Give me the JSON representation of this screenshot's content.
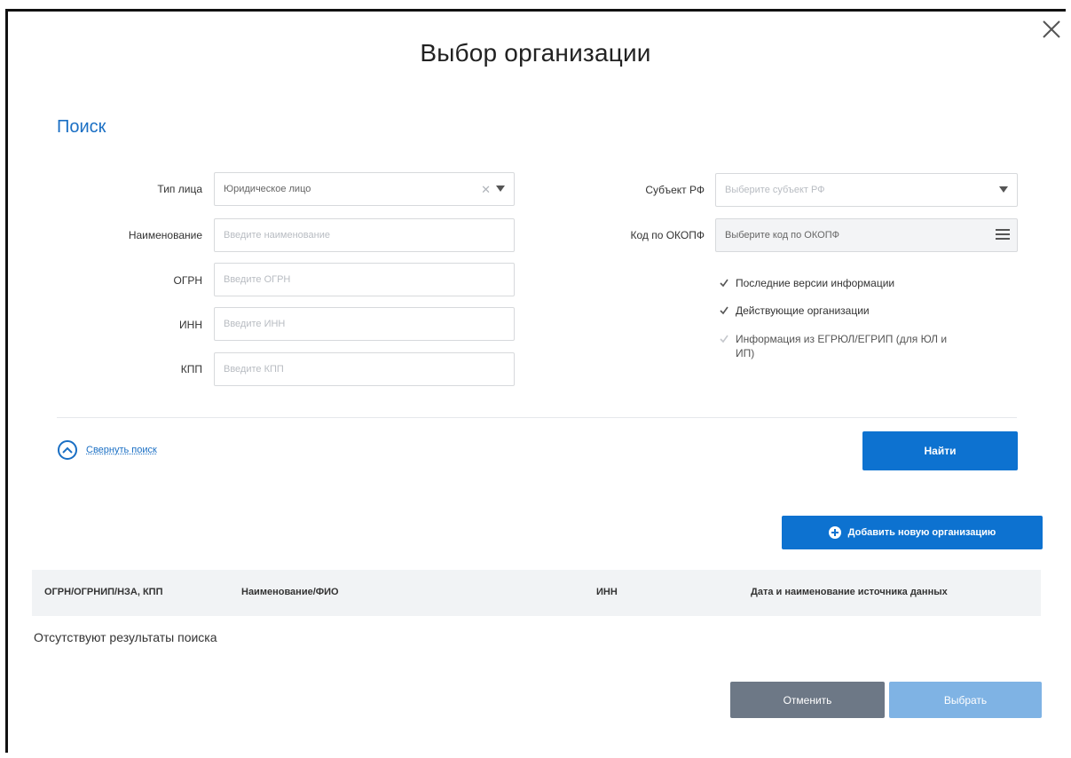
{
  "dialog": {
    "title": "Выбор организации",
    "close_icon": "close-icon"
  },
  "search": {
    "section_title": "Поиск",
    "person_type": {
      "label": "Тип лица",
      "value": "Юридическое лицо"
    },
    "name": {
      "label": "Наименование",
      "placeholder": "Введите наименование"
    },
    "ogrn": {
      "label": "ОГРН",
      "placeholder": "Введите ОГРН"
    },
    "inn": {
      "label": "ИНН",
      "placeholder": "Введите ИНН"
    },
    "kpp": {
      "label": "КПП",
      "placeholder": "Введите КПП"
    },
    "region": {
      "label": "Субъект РФ",
      "placeholder": "Выберите субъект РФ"
    },
    "okopf": {
      "label": "Код по ОКОПФ",
      "placeholder": "Выберите код по ОКОПФ"
    },
    "checkboxes": [
      {
        "label": "Последние версии информации",
        "checked": true
      },
      {
        "label": "Действующие организации",
        "checked": true
      },
      {
        "label": "Информация из ЕГРЮЛ/ЕГРИП (для ЮЛ и ИП)",
        "checked": true,
        "disabled": true
      }
    ],
    "collapse_label": "Свернуть поиск",
    "find_button": "Найти"
  },
  "results": {
    "add_button": "Добавить новую организацию",
    "columns": [
      "ОГРН/ОГРНИП/НЗА, КПП",
      "Наименование/ФИО",
      "ИНН",
      "Дата и наименование источника данных"
    ],
    "empty_message": "Отсутствуют результаты поиска"
  },
  "footer": {
    "cancel_button": "Отменить",
    "select_button": "Выбрать"
  },
  "colors": {
    "accent": "#0d72d0",
    "link": "#1a6fc4",
    "cancel": "#6d7886",
    "select_disabled": "#7fb3e4"
  }
}
